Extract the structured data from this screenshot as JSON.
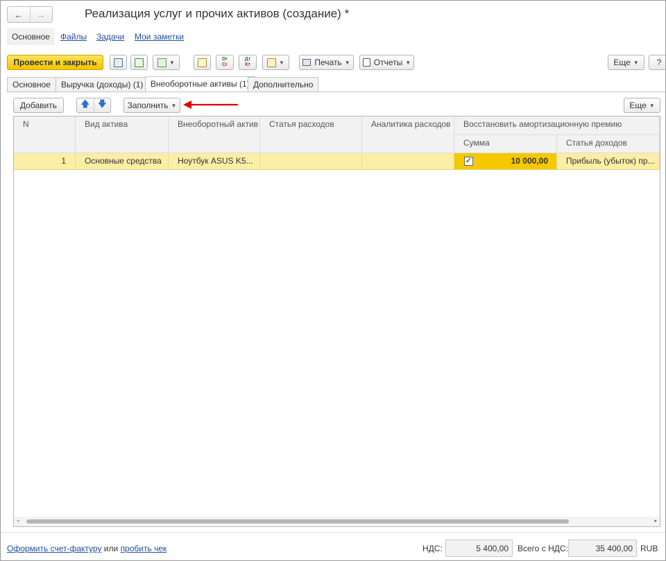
{
  "window": {
    "title": "Реализация услуг и прочих активов (создание) *",
    "nav_back": "←",
    "nav_forward": "→"
  },
  "sections": [
    "Основное",
    "Файлы",
    "Задачи",
    "Мои заметки"
  ],
  "toolbar": {
    "post_close": "Провести и закрыть",
    "print": "Печать",
    "reports": "Отчеты",
    "more": "Еще",
    "help": "?",
    "dt_kt_top": "Dr",
    "dt_kt_bottom": "Cr",
    "ru_top": "Дт",
    "ru_bottom": "Кт"
  },
  "tabs": [
    "Основное",
    "Выручка (доходы) (1)",
    "Внеоборотные активы (1)",
    "Дополнительно"
  ],
  "table_toolbar": {
    "add": "Добавить",
    "fill": "Заполнить",
    "more": "Еще"
  },
  "table": {
    "headers": {
      "n": "N",
      "asset_type": "Вид актива",
      "asset": "Внеоборотный актив",
      "expense_item": "Статья расходов",
      "expense_analytics": "Аналитика расходов",
      "restore_group": "Восстановить амортизационную премию",
      "amount": "Сумма",
      "income_item": "Статья доходов"
    },
    "rows": [
      {
        "n": "1",
        "asset_type": "Основные средства",
        "asset": "Ноутбук ASUS K5...",
        "expense_item": "",
        "expense_analytics": "",
        "restore": true,
        "amount": "10 000,00",
        "income_item": "Прибыль (убыток) пр..."
      }
    ]
  },
  "footer": {
    "invoice_link": "Оформить счет-фактуру",
    "or": "или",
    "receipt_link": "пробить чек",
    "vat_label": "НДС:",
    "vat_value": "5 400,00",
    "total_label": "Всего с НДС:",
    "total_value": "35 400,00",
    "currency": "RUB"
  },
  "colors": {
    "accent_yellow": "#f5c800",
    "selected_row": "#fbeea6",
    "link_blue": "#1f4e9c",
    "annotation_red": "#e00000"
  }
}
